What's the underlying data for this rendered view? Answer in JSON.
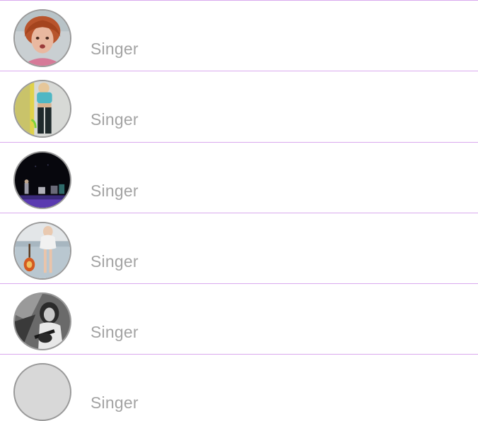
{
  "list": {
    "items": [
      {
        "subtitle": "Singer",
        "avatar_icon": "redhead-woman-photo"
      },
      {
        "subtitle": "Singer",
        "avatar_icon": "woman-standing-photo"
      },
      {
        "subtitle": "Singer",
        "avatar_icon": "concert-stage-photo"
      },
      {
        "subtitle": "Singer",
        "avatar_icon": "woman-with-guitar-photo"
      },
      {
        "subtitle": "Singer",
        "avatar_icon": "guitarist-bw-photo"
      },
      {
        "subtitle": "Singer",
        "avatar_icon": "placeholder-avatar"
      }
    ]
  },
  "colors": {
    "separator": "#d9a8ee",
    "subtitle_text": "#a3a3a3",
    "avatar_border": "#9a9a9a",
    "placeholder_fill": "#d8d8d8"
  }
}
